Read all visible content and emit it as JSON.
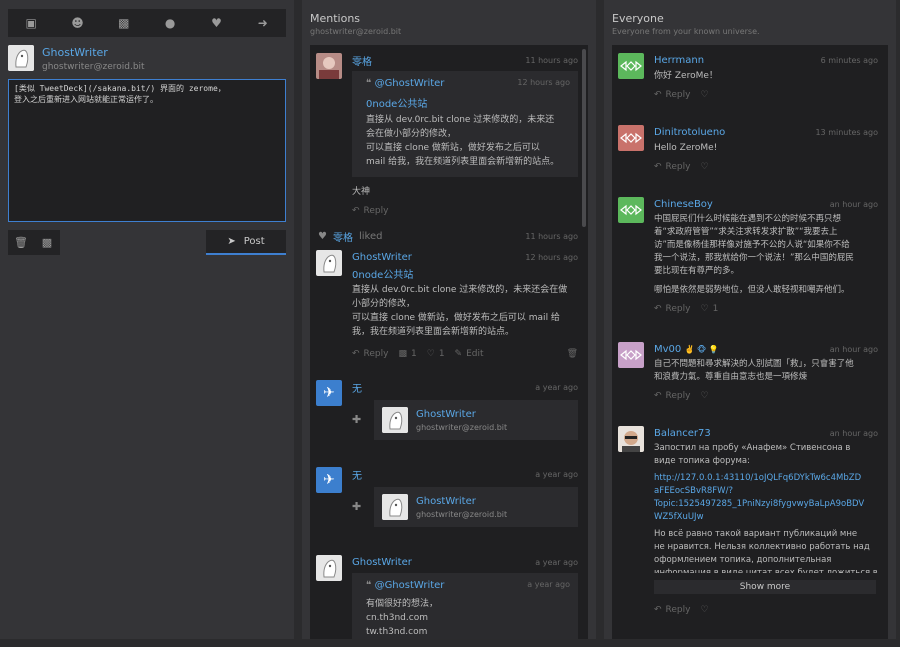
{
  "toolbar": {
    "icons": [
      "contacts-icon",
      "users-icon",
      "image-icon",
      "globe-icon",
      "heart-icon",
      "logout-icon"
    ]
  },
  "me": {
    "name": "GhostWriter",
    "address": "ghostwriter@zeroid.bit"
  },
  "composer": {
    "value": "[类似 TweetDeck](/sakana.bit/) 界面的 zerome，\n登入之后重新进入网站就能正常运作了。"
  },
  "compose_tools": {
    "post_label": "Post"
  },
  "mentions": {
    "title": "Mentions",
    "subtitle": "ghostwriter@zeroid.bit",
    "posts": [
      {
        "name": "零格",
        "time": "11 hours ago",
        "quote": {
          "name": "@GhostWriter",
          "time": "12 hours ago",
          "sub": "0node公共站",
          "lines": [
            "直接从 dev.0rc.bit clone 过来修改的，未来还",
            "会在做小部分的修改，",
            "可以直接 clone 做新站，做好发布之后可以",
            "mail 给我，我在频道列表里面会新增新的站点。"
          ]
        },
        "text": "大神",
        "reply": "Reply"
      },
      {
        "liker": "零格",
        "liked_label": "liked",
        "time": "11 hours ago"
      },
      {
        "name": "GhostWriter",
        "time": "12 hours ago",
        "sub": "0node公共站",
        "lines": [
          "直接从 dev.0rc.bit clone 过来修改的，未来还会在做",
          "小部分的修改，",
          "可以直接 clone 做新站，做好发布之后可以 mail 给",
          "我，我在频道列表里面会新增新的站点。"
        ],
        "reply": "Reply",
        "comments": "1",
        "likes": "1",
        "edit": "Edit"
      },
      {
        "name": "无",
        "time": "a year ago",
        "follow_name": "GhostWriter",
        "follow_address": "ghostwriter@zeroid.bit"
      },
      {
        "name": "无",
        "time": "a year ago",
        "follow_name": "GhostWriter",
        "follow_address": "ghostwriter@zeroid.bit"
      },
      {
        "name": "GhostWriter",
        "time": "a year ago",
        "quote": {
          "name": "@GhostWriter",
          "time": "a year ago",
          "lines": [
            "有個很好的想法，",
            "cn.th3nd.com",
            "tw.th3nd.com"
          ]
        }
      }
    ]
  },
  "everyone": {
    "title": "Everyone",
    "subtitle": "Everyone from your known universe.",
    "posts": [
      {
        "name": "Herrmann",
        "time": "6 minutes ago",
        "lines": [
          "你好 ZeroMe！"
        ],
        "reply": "Reply",
        "color": "#5cb85c"
      },
      {
        "name": "Dinitrotolueno",
        "time": "13 minutes ago",
        "lines": [
          "Hello ZeroMe!"
        ],
        "reply": "Reply",
        "color": "#c9726b"
      },
      {
        "name": "ChineseBoy",
        "time": "an hour ago",
        "lines": [
          "中国屁民们什么时候能在遇到不公的时候不再只想",
          "着“求政府管管”“求关注求转发求扩散”“我要去上",
          "访”而是像杨佳那样像对施予不公的人说“如果你不给",
          "我一个说法，那我就给你一个说法！”那么中国的屁民",
          "要比现在有尊严的多。"
        ],
        "extra": "哪怕是依然是弱势地位，但没人敢轻视和嘲弄他们。",
        "reply": "Reply",
        "likes": "1",
        "color": "#5cb85c"
      },
      {
        "name": "Mv00",
        "badges": "✌️ 🐵 💡",
        "time": "an hour ago",
        "lines": [
          "自己不問題和尋求解決的人別試圖「救」，只會害了他",
          "和浪費力氣。尊重自由意志也是一項修煉"
        ],
        "reply": "Reply",
        "color": "#c7a0c8"
      },
      {
        "name": "Balancer73",
        "time": "an hour ago",
        "lines": [
          "Запостил на пробу «Анафем» Стивенсона в",
          "виде топика форума:"
        ],
        "link": [
          "http://127.0.0.1:43110/1oJQLFq6DYkTw6c4MbZD",
          "aFEEocSBvR8FW/?",
          "Topic:1525497285_1PniNzyi8fygvwyBaLpA9oBDV",
          "WZ5fXuUJw"
        ],
        "lines2": [
          "Но всё равно такой вариант публикаций мне",
          "не нравится. Нельзя коллективно работать над",
          "оформлением топика, дополнительная",
          "информация в виде цитат всех будет ложиться в"
        ],
        "show_more": "Show more",
        "reply": "Reply"
      }
    ]
  },
  "colors": {
    "accent": "#5aa7e6",
    "panel": "#343437",
    "feed_bg": "#1f1f21"
  }
}
